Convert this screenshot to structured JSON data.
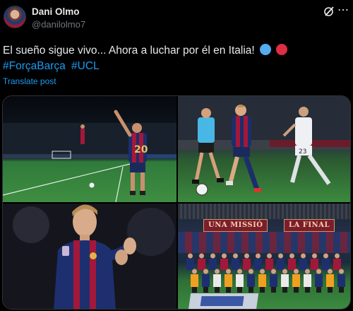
{
  "author": {
    "name": "Dani Olmo",
    "handle": "@danilolmo7"
  },
  "tweet": {
    "text": "El sueño sigue vivo... Ahora a luchar por él en Italia!",
    "emojis": [
      "blue-circle-emoji",
      "red-circle-emoji"
    ],
    "hashtags": [
      "#ForçaBarça",
      "#UCL"
    ],
    "translate_label": "Translate post"
  },
  "media": {
    "photo4": {
      "banner_left": "UNA MISSIÓ",
      "banner_right": "LA FINAL"
    }
  },
  "icons": {
    "grok": "grok-icon",
    "more": "more-icon"
  },
  "colors": {
    "background": "#000000",
    "text": "#e7e9ea",
    "secondary_text": "#71767b",
    "link": "#1d9bf0"
  }
}
